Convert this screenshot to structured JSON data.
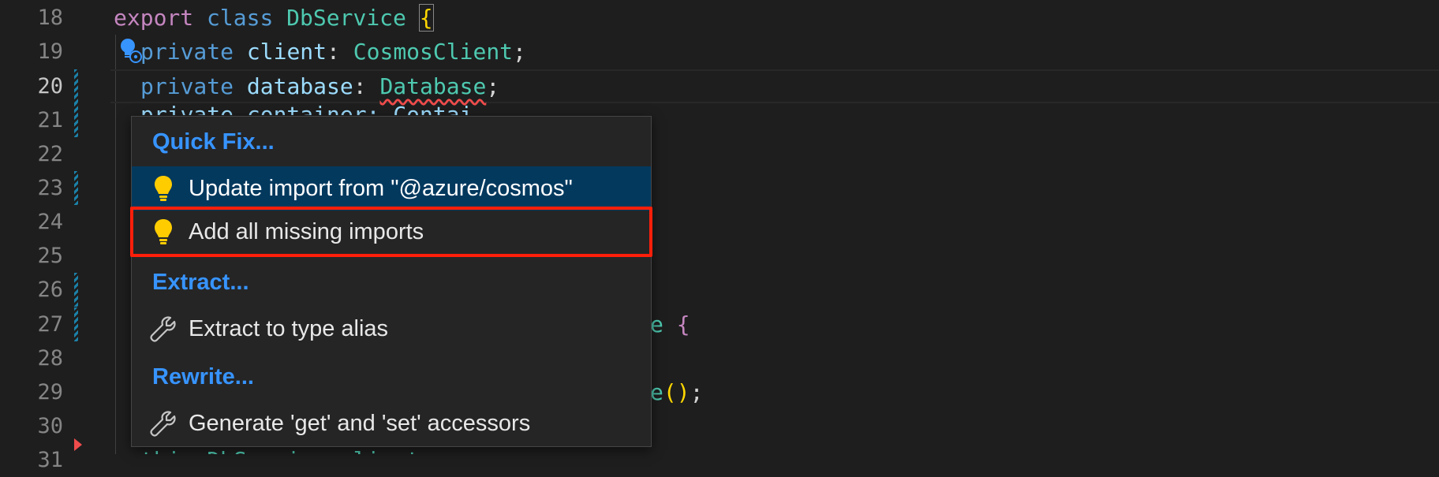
{
  "editor": {
    "line_numbers": [
      "18",
      "19",
      "20",
      "21",
      "22",
      "23",
      "24",
      "25",
      "26",
      "27",
      "28",
      "29",
      "30",
      "31"
    ],
    "active_line": "20",
    "lines": {
      "l18": {
        "kw1": "export",
        "kw2": "class",
        "cls": "DbService",
        "brace": "{"
      },
      "l19": {
        "kw": "private",
        "prop": "client",
        "colon": ":",
        "type": "CosmosClient",
        "semi": ";"
      },
      "l20": {
        "kw": "private",
        "prop": "database",
        "colon": ":",
        "type": "Database",
        "semi": ";"
      },
      "l21": {
        "partial": "private container: Contai"
      },
      "l27": {
        "tail": "e",
        "brace": "{"
      },
      "l29": {
        "tail": "e",
        "paren": "()",
        "semi": ";"
      },
      "l31": {
        "partial": "this.DbService.client"
      }
    }
  },
  "quick_menu": {
    "sections": [
      {
        "header": "Quick Fix...",
        "items": [
          {
            "label": "Update import from \"@azure/cosmos\"",
            "icon": "lightbulb-icon"
          },
          {
            "label": "Add all missing imports",
            "icon": "lightbulb-icon"
          }
        ]
      },
      {
        "header": "Extract...",
        "items": [
          {
            "label": "Extract to type alias",
            "icon": "wrench-icon"
          }
        ]
      },
      {
        "header": "Rewrite...",
        "items": [
          {
            "label": "Generate 'get' and 'set' accessors",
            "icon": "wrench-icon"
          }
        ]
      }
    ]
  },
  "colors": {
    "background": "#1e1e1e",
    "menu_background": "#252526",
    "menu_header": "#3794ff",
    "selected_item": "#04395e",
    "highlight_outline": "#ff1f0a",
    "lightbulb": "#ffcc00"
  }
}
